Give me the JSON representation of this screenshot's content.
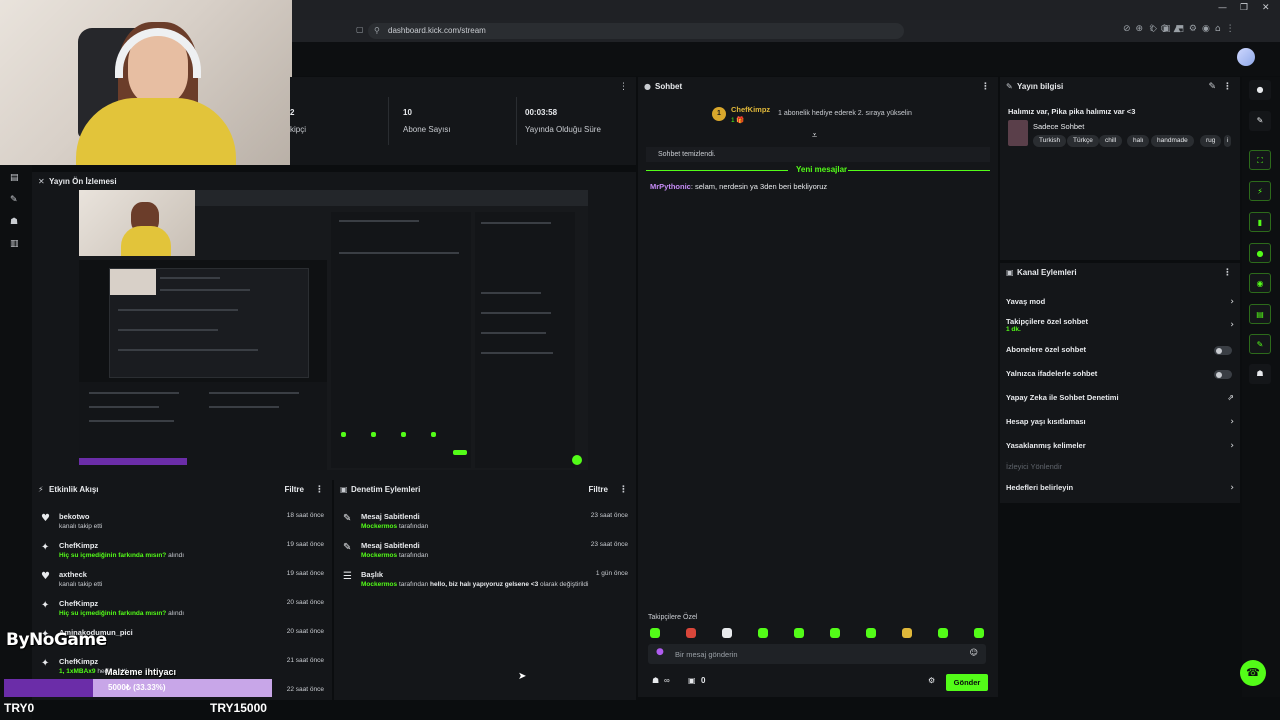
{
  "browser": {
    "url": "dashboard.kick.com/stream"
  },
  "stats": {
    "viewers_partial": "2",
    "followers_partial": "kipçi",
    "subs_value": "10",
    "subs_label": "Abone Sayısı",
    "uptime_value": "00:03:58",
    "uptime_label": "Yayında Olduğu Süre"
  },
  "preview": {
    "title": "Yayın Ön İzlemesi"
  },
  "activity": {
    "title": "Etkinlik Akışı",
    "filter_label": "Filtre",
    "items": [
      {
        "icon": "heart-icon",
        "name": "bekotwo",
        "detail": "kanalı takip etti",
        "ago": "18 saat önce"
      },
      {
        "icon": "gift-icon",
        "name": "ChefKimpz",
        "detail_link": "Hiç su içmediğinin farkında mısın?",
        "detail_suffix": "alındı",
        "ago": "19 saat önce"
      },
      {
        "icon": "heart-icon",
        "name": "axtheck",
        "detail": "kanalı takip etti",
        "ago": "19 saat önce"
      },
      {
        "icon": "gift-icon",
        "name": "ChefKimpz",
        "detail_link": "Hiç su içmediğinin farkında mısın?",
        "detail_suffix": "alındı",
        "ago": "20 saat önce"
      },
      {
        "icon": "gift-icon",
        "name": "Aminakodumun_pici",
        "detail": "",
        "ago": "20 saat önce"
      },
      {
        "icon": "gift-icon",
        "name": "ChefKimpz",
        "detail_link": "1, 1xMBAx9",
        "detail_suffix": "hediye etti.",
        "ago": "21 saat önce"
      }
    ],
    "last_ago": "22 saat önce"
  },
  "moderation": {
    "title": "Denetim Eylemleri",
    "filter_label": "Filtre",
    "items": [
      {
        "icon": "pin-icon",
        "title": "Mesaj Sabitlendi",
        "by": "Mockermos",
        "suffix": "tarafından",
        "ago": "23 saat önce"
      },
      {
        "icon": "pin-icon",
        "title": "Mesaj Sabitlendi",
        "by": "Mockermos",
        "suffix": "tarafından",
        "ago": "23 saat önce"
      },
      {
        "icon": "title-icon",
        "title": "Başlık",
        "by": "Mockermos",
        "suffix": "tarafından",
        "bold_text": "hello, biz halı yapıyoruz gelsene <3",
        "suffix2": "olarak değiştirildi",
        "ago": "1 gün önce"
      }
    ]
  },
  "chat": {
    "title": "Sohbet",
    "pinned_rank": "1",
    "pinned_user": "ChefKimpz",
    "pinned_badge": "1 🎁",
    "pinned_message": "1 abonelik hediye ederek 2. sıraya yükselin",
    "cleared": "Sohbet temizlendi.",
    "new_messages": "Yeni mesajlar",
    "message_user": "MrPythonic",
    "message_text": ": selam, nerdesin ya 3den beri bekliyoruz",
    "followers_only": "Takipçilere Özel",
    "input_placeholder": "Bir mesaj gönderin",
    "viewer_count_label": "∞",
    "store_count": "0",
    "send_label": "Gönder"
  },
  "stream_info": {
    "title": "Yayın bilgisi",
    "stream_title": "Halımız var, Pika pika halımız var <3",
    "category": "Sadece Sohbet",
    "tags": [
      "Turkish",
      "Türkçe",
      "chill",
      "halı",
      "handmade",
      "rug",
      "i"
    ]
  },
  "channel_actions": {
    "title": "Kanal Eylemleri",
    "slow_mode": "Yavaş mod",
    "followers_chat": "Takipçilere özel sohbet",
    "followers_chat_sub": "1 dk.",
    "subs_chat": "Abonelere özel sohbet",
    "emotes_chat": "Yalnızca ifadelerle sohbet",
    "ai_mod": "Yapay Zeka ile Sohbet Denetimi",
    "account_age": "Hesap yaşı kısıtlaması",
    "banned_words": "Yasaklanmış kelimeler",
    "viewer_redirect": "İzleyici Yönlendir",
    "targets": "Hedefleri belirleyin"
  },
  "overlay": {
    "watermark": "ByNoGame",
    "goal_label": "Malzeme ihtiyacı",
    "goal_text": "5000₺ (33.33%)",
    "goal_progress": 0.3333,
    "goal_min": "TRY0",
    "goal_max": "TRY15000"
  },
  "colors": {
    "accent": "#53fc18",
    "background": "#0b0d0f",
    "panel": "#141619",
    "goal_fill": "#6b2da8",
    "username_chat": "#c78cf7"
  }
}
